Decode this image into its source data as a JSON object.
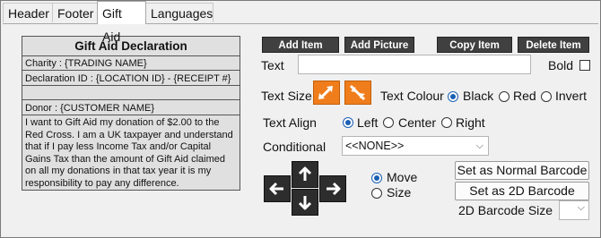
{
  "tabs": [
    "Header",
    "Footer",
    "Gift Aid",
    "Languages"
  ],
  "preview": {
    "title": "Gift Aid Declaration",
    "charity": "Charity : {TRADING NAME}",
    "declaration_id": "Declaration ID : {LOCATION ID} - {RECEIPT #}",
    "donor": "Donor : {CUSTOMER NAME}",
    "message": "I want to Gift Aid my donation of $2.00 to the Red Cross. I am a UK taxpayer and understand that if I pay less Income Tax and/or Capital Gains Tax than the amount of Gift Aid claimed on all my donations in that tax year it is my responsibility to pay any difference."
  },
  "toolbar": {
    "add_item": "Add Item",
    "add_picture": "Add Picture",
    "copy_item": "Copy Item",
    "delete_item": "Delete Item"
  },
  "form": {
    "text_label": "Text",
    "text_value": "",
    "bold_label": "Bold",
    "text_size_label": "Text Size",
    "text_colour_label": "Text Colour",
    "colour_black": "Black",
    "colour_red": "Red",
    "colour_invert": "Invert",
    "text_align_label": "Text Align",
    "align_left": "Left",
    "align_center": "Center",
    "align_right": "Right",
    "conditional_label": "Conditional",
    "conditional_value": "<<NONE>>",
    "move_label": "Move",
    "size_label": "Size",
    "set_normal_barcode": "Set as Normal Barcode",
    "set_2d_barcode": "Set as 2D Barcode",
    "barcode_size_label": "2D Barcode Size",
    "barcode_size_value": ""
  },
  "state": {
    "bold": false,
    "text_colour": "Black",
    "text_align": "Left",
    "mode": "Move"
  },
  "colors": {
    "accent_orange": "#f07d1c",
    "toolbar_dark": "#404040",
    "radio_blue": "#1a5fb4"
  },
  "icons": [
    "increase-size-icon",
    "decrease-size-icon",
    "arrow-left-icon",
    "arrow-up-icon",
    "arrow-down-icon",
    "arrow-right-icon",
    "chevron-down-icon"
  ]
}
